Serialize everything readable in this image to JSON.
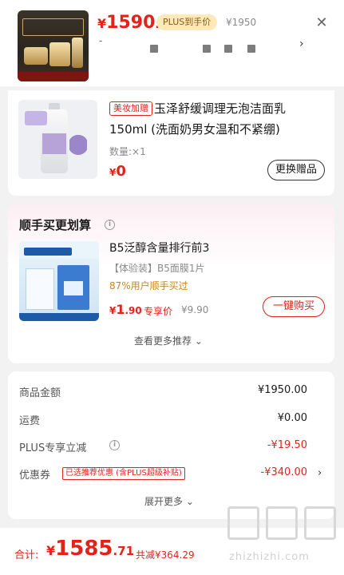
{
  "sku": {
    "price_yen": "¥",
    "price_int": "1590",
    "price_dec": ".5",
    "plus_tag": "PLUS到手价",
    "ref_price": "¥1950",
    "spec_dash": "-",
    "close_icon": "close-icon",
    "arrow_icon": "chevron-right-icon"
  },
  "gift": {
    "tag": "美妆加赠",
    "title_line1": "玉泽舒缓调理无泡洁面乳",
    "title_line2": "150ml (洗面奶男女温和不紧绷)",
    "qty": "数量:×1",
    "price_yen": "¥",
    "price_int": "0",
    "swap_label": "更换赠品"
  },
  "addon": {
    "title": "顺手买更划算",
    "info_icon": "info-icon",
    "item": {
      "name": "B5泛醇含量排行前3",
      "spec": "【体验装】B5面膜1片",
      "pct": "87%用户顺手买过",
      "price_yen": "¥",
      "price_int": "1",
      "price_dec": ".90",
      "price_label": "专享价",
      "orig_price": "¥9.90",
      "buy_label": "一键购买"
    },
    "more_label": "查看更多推荐 ⌄"
  },
  "summary": {
    "rows": [
      {
        "label": "商品金额",
        "value": "¥1950.00"
      },
      {
        "label": "运费",
        "value": "¥0.00"
      },
      {
        "label": "PLUS专享立减",
        "value": "-¥19.50"
      },
      {
        "label": "优惠券",
        "value": "-¥340.00"
      }
    ],
    "coupon_tag": "已选推荐优惠 (含PLUS超级补贴)",
    "expand_label": "展开更多 ⌄"
  },
  "footer": {
    "total_label": "合计:",
    "total_yen": "¥",
    "total_int": "1585",
    "total_dec": ".71",
    "saved": "共减¥364.29",
    "watermark": "zhizhizhi.com"
  },
  "colors": {
    "accent": "#e2231a",
    "plus_bg": "#ffe9b8"
  }
}
